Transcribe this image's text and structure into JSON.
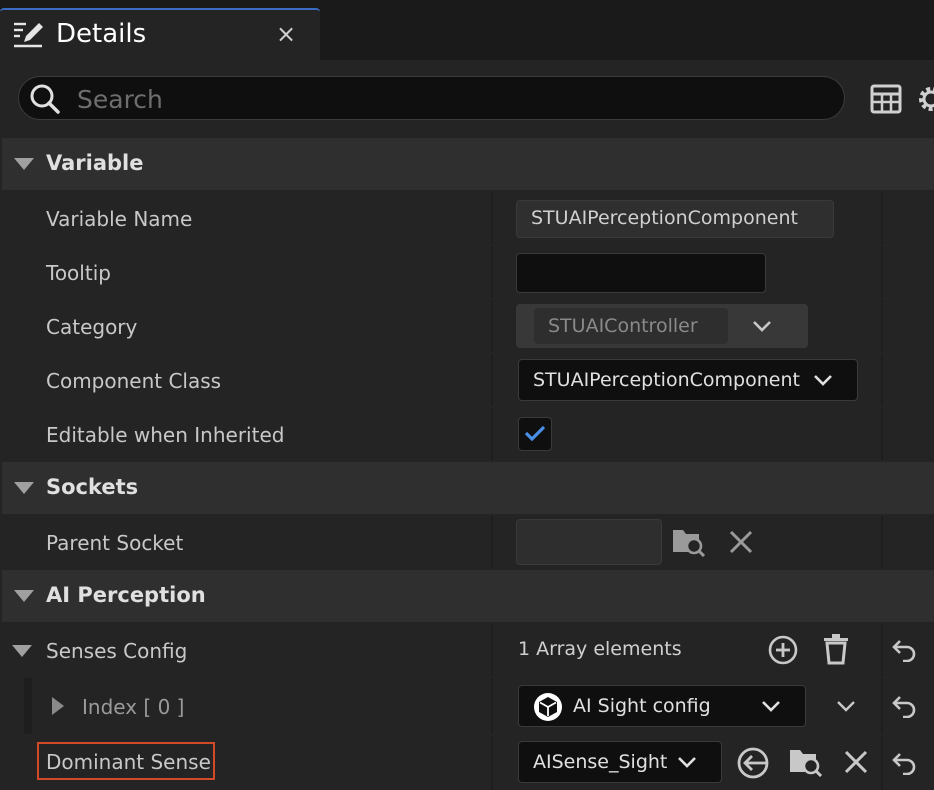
{
  "tab": {
    "title": "Details",
    "close_glyph": "×",
    "icon": "edit-list-icon"
  },
  "search": {
    "placeholder": "Search",
    "value": ""
  },
  "toolbar": {
    "icons": [
      "grid-view-icon",
      "settings-gear-icon"
    ]
  },
  "categories": {
    "variable": "Variable",
    "sockets": "Sockets",
    "ai_perception": "AI Perception"
  },
  "variable": {
    "name_label": "Variable Name",
    "name_value": "STUAIPerceptionComponent",
    "tooltip_label": "Tooltip",
    "tooltip_value": "",
    "category_label": "Category",
    "category_value": "STUAIController",
    "component_class_label": "Component Class",
    "component_class_value": "STUAIPerceptionComponent",
    "editable_label": "Editable when Inherited",
    "editable_checked": true
  },
  "sockets": {
    "parent_socket_label": "Parent Socket",
    "parent_socket_value": ""
  },
  "ai_perception": {
    "senses_config_label": "Senses Config",
    "senses_config_value": "1 Array elements",
    "index_label": "Index",
    "index_bracket": "[ 0 ]",
    "index_value": "AI Sight config",
    "dominant_sense_label": "Dominant Sense",
    "dominant_sense_value": "AISense_Sight"
  },
  "colors": {
    "accent": "#3a6cc4",
    "checkmark": "#4a90e8",
    "highlight_box": "#d04a2a"
  }
}
